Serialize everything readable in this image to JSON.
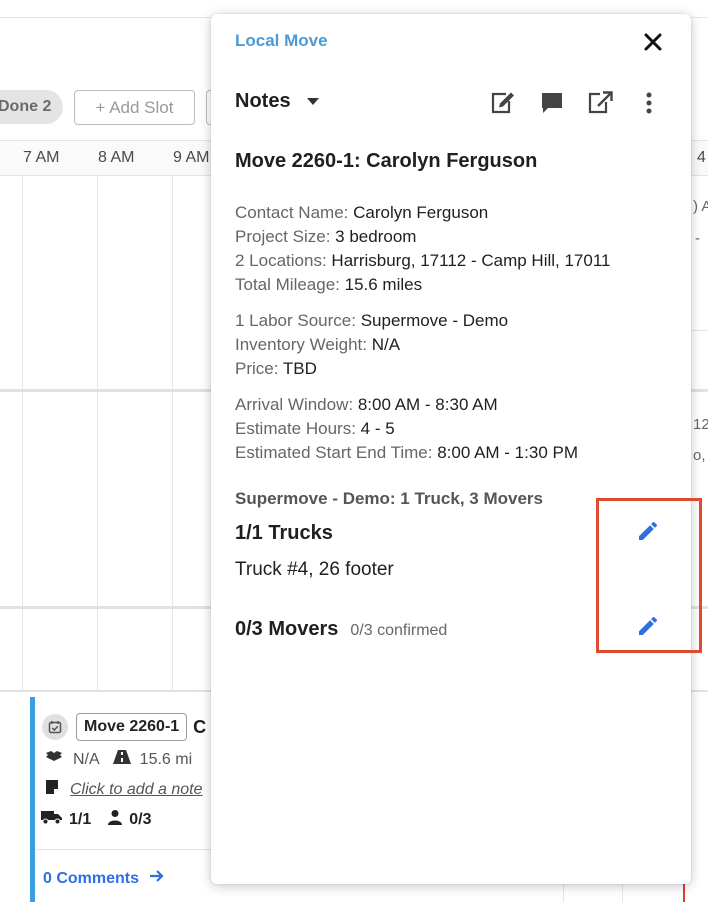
{
  "toolbar": {
    "done_chip": "Done 2",
    "add_slot": "+ Add Slot"
  },
  "timeline": {
    "hours": [
      "7 AM",
      "8 AM",
      "9 AM"
    ],
    "right_fragments": [
      "4",
      ") A",
      "-",
      "12",
      "o,"
    ]
  },
  "job_card": {
    "move_tag": "Move 2260-1",
    "name_fragment": "C",
    "weight": "N/A",
    "mileage": "15.6 mi",
    "note_placeholder": "Click to add a note",
    "trucks": "1/1",
    "movers": "0/3",
    "comments": "0 Comments"
  },
  "panel": {
    "type_label": "Local Move",
    "view_selector": "Notes",
    "title": "Move 2260-1: Carolyn Ferguson",
    "details": {
      "contact_name_label": "Contact Name:",
      "contact_name": "Carolyn Ferguson",
      "project_size_label": "Project Size:",
      "project_size": "3 bedroom",
      "locations_label": "2 Locations:",
      "locations": "Harrisburg, 17112 - Camp Hill, 17011",
      "mileage_label": "Total Mileage:",
      "mileage": "15.6 miles",
      "labor_label": "1 Labor Source:",
      "labor": "Supermove - Demo",
      "weight_label": "Inventory Weight:",
      "weight": "N/A",
      "price_label": "Price:",
      "price": "TBD",
      "arrival_label": "Arrival Window:",
      "arrival": "8:00 AM - 8:30 AM",
      "est_hours_label": "Estimate Hours:",
      "est_hours": "4 - 5",
      "est_time_label": "Estimated Start End Time:",
      "est_time": "8:00 AM - 1:30 PM"
    },
    "crew": {
      "title": "Supermove - Demo: 1 Truck, 3 Movers",
      "trucks_title": "1/1 Trucks",
      "truck_item": "Truck #4, 26 footer",
      "movers_title": "0/3 Movers",
      "movers_confirmed": "0/3 confirmed"
    }
  },
  "colors": {
    "accent_blue": "#2f6fde",
    "type_label": "#4a9bd6",
    "highlight": "#e04a2f"
  },
  "icons": [
    "close-icon",
    "chevron-down-icon",
    "edit-note-icon",
    "comment-icon",
    "open-external-icon",
    "more-vertical-icon",
    "pencil-icon",
    "calendar-check-icon",
    "boxes-icon",
    "road-icon",
    "note-icon",
    "truck-icon",
    "person-icon",
    "arrow-right-icon"
  ]
}
